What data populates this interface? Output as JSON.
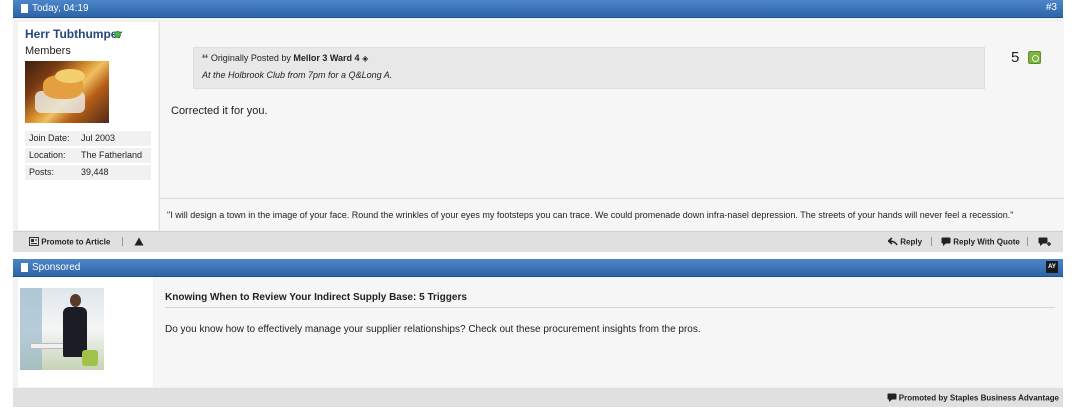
{
  "post": {
    "header": {
      "date": "Today, 04:19",
      "number": "#3"
    },
    "user": {
      "name": "Herr Tubthumper",
      "title": "Members",
      "stats": [
        {
          "label": "Join Date:",
          "value": "Jul 2003"
        },
        {
          "label": "Location:",
          "value": "The Fatherland"
        },
        {
          "label": "Posts:",
          "value": "39,448"
        }
      ]
    },
    "quote": {
      "prefix": "Originally Posted by",
      "author": "Mellor 3 Ward 4",
      "text": "At the Holbrook Club from 7pm for a Q&Long A."
    },
    "reputation": "5",
    "body": "Corrected it for you.",
    "signature": "\"I will design a town in the image of your face. Round the wrinkles of your eyes my footsteps you can trace. We could promenade down infra-nasel depression. The streets of your hands will never feel a recession.\"",
    "footer": {
      "promote": "Promote to Article",
      "reply": "Reply",
      "reply_quote": "Reply With Quote"
    }
  },
  "sponsored": {
    "header": "Sponsored",
    "badge": "AY",
    "title": "Knowing When to Review Your Indirect Supply Base: 5 Triggers",
    "text": "Do you know how to effectively manage your supplier relationships? Check out these procurement insights from the pros.",
    "promoted_by": "Promoted by Staples Business Advantage"
  },
  "colors": {
    "header_bar": "#2c64a8",
    "username": "#23497c",
    "online": "#52b04a",
    "rep_icon": "#7cb342"
  }
}
